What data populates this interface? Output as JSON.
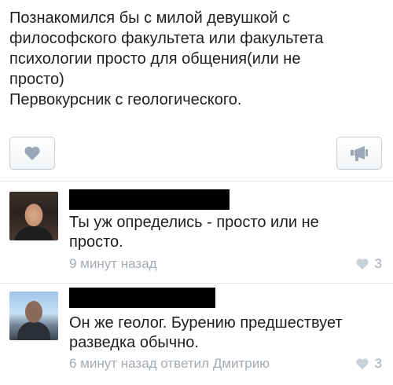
{
  "post": {
    "lines": [
      "Познакомился бы с милой девушкой с",
      "философского факультета или факультета",
      "психологии просто для общения(или не",
      "просто)",
      "Первокурсник с геологического."
    ]
  },
  "actions": {
    "like_icon": "heart-icon",
    "share_icon": "megaphone-icon"
  },
  "comments": [
    {
      "author": "",
      "text_lines": [
        "Ты уж определись - просто или не",
        "просто."
      ],
      "time": "9 минут назад",
      "likes": "3"
    },
    {
      "author": "",
      "text_lines": [
        "Он же геолог. Бурению предшествует",
        "разведка обычно."
      ],
      "time": "6 минут назад ответил Дмитрию",
      "likes": "3"
    }
  ],
  "colors": {
    "meta_text": "#a3abb4",
    "button_icon": "#9aa7b6",
    "divider": "#e3e6ea"
  }
}
